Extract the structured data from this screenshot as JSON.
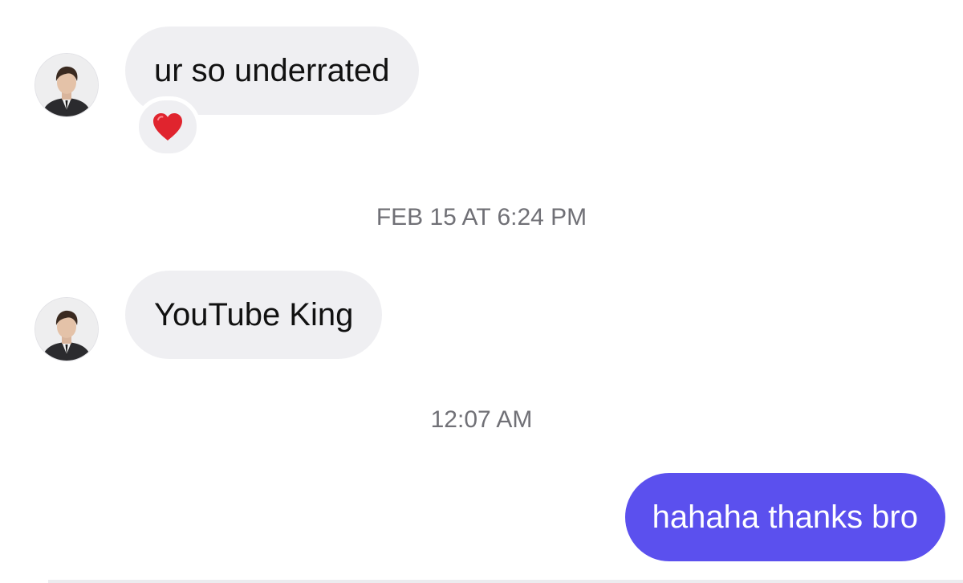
{
  "conversation": {
    "messages": [
      {
        "direction": "incoming",
        "text": "ur so underrated",
        "reaction": "❤️"
      },
      {
        "direction": "incoming",
        "text": "YouTube King"
      },
      {
        "direction": "outgoing",
        "text": "hahaha thanks bro"
      }
    ],
    "timestamps": [
      "FEB 15 AT 6:24 PM",
      "12:07 AM"
    ]
  },
  "icons": {
    "avatar": "user-avatar-photo",
    "reaction": "heart-icon"
  },
  "colors": {
    "incoming_bubble": "#efeff2",
    "outgoing_bubble": "#5b50ee",
    "timestamp_text": "#707076",
    "heart": "#e0242e"
  }
}
